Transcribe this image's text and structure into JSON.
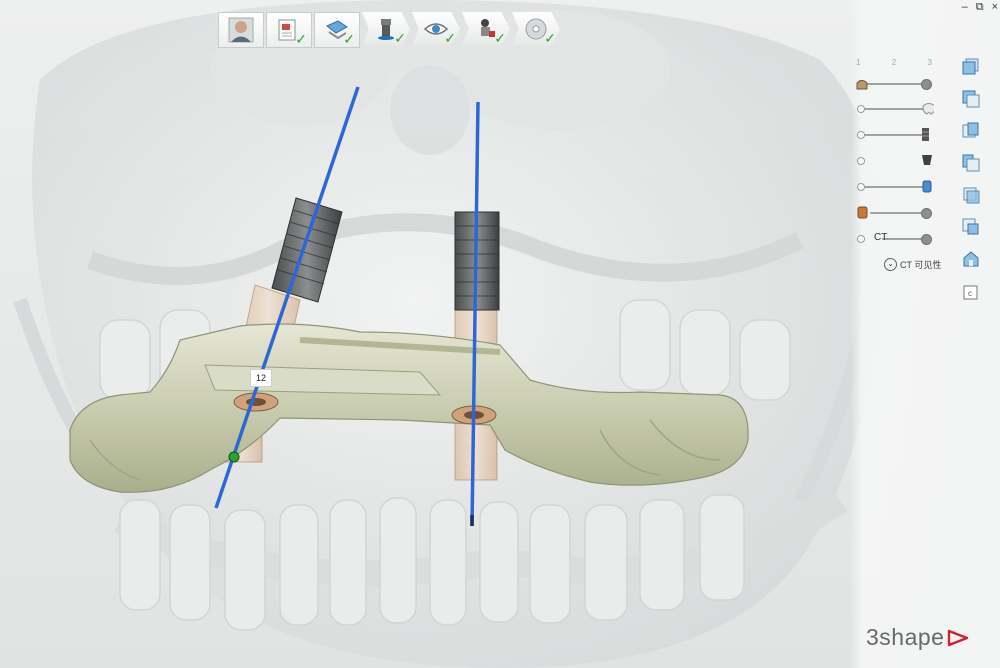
{
  "window": {
    "minimize_glyph": "–",
    "restore_glyph": "⧉",
    "close_glyph": "×"
  },
  "workflow": {
    "steps": [
      {
        "icon": "patient-photo-icon",
        "completed": false
      },
      {
        "icon": "case-document-icon",
        "completed": true
      },
      {
        "icon": "scan-import-icon",
        "completed": true
      },
      {
        "icon": "implant-planning-icon",
        "completed": true
      },
      {
        "icon": "eye-view-icon",
        "completed": true
      },
      {
        "icon": "sleeve-guide-icon",
        "completed": true
      },
      {
        "icon": "disc-export-icon",
        "completed": true
      }
    ],
    "check_glyph": "✓"
  },
  "visibility": {
    "columns": [
      "1",
      "2",
      "3"
    ],
    "rows": [
      {
        "icon": "jaw-model-icon"
      },
      {
        "icon": "tooth-crown-icon"
      },
      {
        "icon": "implant-screw-icon"
      },
      {
        "icon": "abutment-icon"
      },
      {
        "icon": "sleeve-cylinder-icon"
      },
      {
        "icon": "drill-sleeve-icon"
      },
      {
        "icon": "ct-volume-icon",
        "label": "CT"
      }
    ],
    "ct_toggle_label": "CT 可见性"
  },
  "views": [
    "front-view-icon",
    "back-view-icon",
    "left-view-icon",
    "right-view-icon",
    "top-view-icon",
    "bottom-view-icon",
    "home-view-icon",
    "snapshot-icon"
  ],
  "scene": {
    "site_label": "12"
  },
  "brand": {
    "name": "3shape"
  },
  "colors": {
    "accent_blue": "#3a6fd8",
    "guide_green": "#c9ccb2",
    "check_green": "#2fa12f",
    "sleeve_tan": "#e3c2a2"
  }
}
